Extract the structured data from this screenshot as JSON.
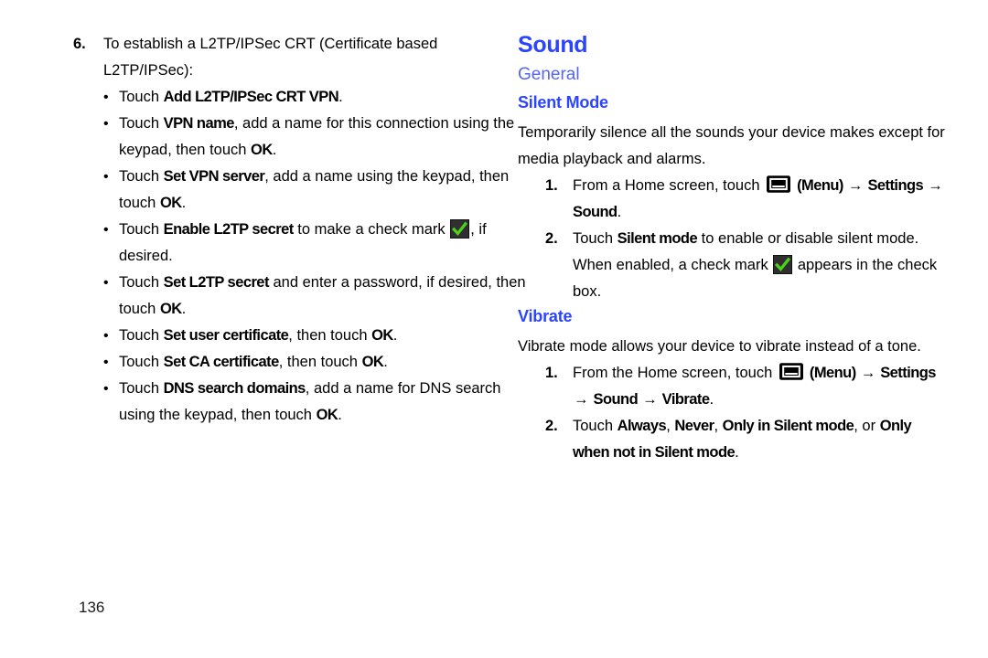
{
  "page": {
    "number": "136",
    "accent_blue": "#2b44ff",
    "section_blue": "#5566f2"
  },
  "left_column": {
    "step": {
      "number": "6.",
      "text_before": "To establish a L2TP/IPSec CRT (Certificate based L2TP/IPSec):"
    },
    "bullets": [
      {
        "id": "add-l2tp-ipsec-crt-vpn",
        "parts": [
          {
            "t": "Touch ",
            "b": false
          },
          {
            "t": "Add L2TP/IPSec CRT VPN",
            "b": true
          },
          {
            "t": ".",
            "b": false
          }
        ]
      },
      {
        "id": "vpn-name",
        "parts": [
          {
            "t": "Touch ",
            "b": false
          },
          {
            "t": "VPN name",
            "b": true
          },
          {
            "t": ", add a name for this connection using the keypad, then touch ",
            "b": false
          },
          {
            "t": "OK",
            "b": true
          },
          {
            "t": ".",
            "b": false
          }
        ]
      },
      {
        "id": "set-vpn-server",
        "parts": [
          {
            "t": "Touch ",
            "b": false
          },
          {
            "t": "Set VPN server",
            "b": true
          },
          {
            "t": ", add a name using the keypad, then touch ",
            "b": false
          },
          {
            "t": "OK",
            "b": true
          },
          {
            "t": ".",
            "b": false
          }
        ]
      },
      {
        "id": "enable-l2tp-secret",
        "parts": [
          {
            "t": "Touch ",
            "b": false
          },
          {
            "t": "Enable L2TP secret",
            "b": true
          },
          {
            "t": " to make a check mark ",
            "b": false
          },
          {
            "t": "",
            "icon": "checkbox-checked-icon"
          },
          {
            "t": ", if desired.",
            "b": false
          }
        ]
      },
      {
        "id": "set-l2tp-secret",
        "parts": [
          {
            "t": "Touch ",
            "b": false
          },
          {
            "t": "Set L2TP secret",
            "b": true
          },
          {
            "t": " and enter a password, if desired, then touch ",
            "b": false
          },
          {
            "t": "OK",
            "b": true
          },
          {
            "t": ".",
            "b": false
          }
        ]
      },
      {
        "id": "set-user-certificate",
        "parts": [
          {
            "t": "Touch ",
            "b": false
          },
          {
            "t": "Set user certificate",
            "b": true
          },
          {
            "t": ", then touch ",
            "b": false
          },
          {
            "t": "OK",
            "b": true
          },
          {
            "t": ".",
            "b": false
          }
        ]
      },
      {
        "id": "set-ca-certificate",
        "parts": [
          {
            "t": "Touch ",
            "b": false
          },
          {
            "t": "Set CA certificate",
            "b": true
          },
          {
            "t": ", then touch ",
            "b": false
          },
          {
            "t": "OK",
            "b": true
          },
          {
            "t": ".",
            "b": false
          }
        ]
      },
      {
        "id": "dns-search-domains",
        "parts": [
          {
            "t": "Touch ",
            "b": false
          },
          {
            "t": "DNS search domains",
            "b": true
          },
          {
            "t": ", add a name for DNS search using the keypad, then touch ",
            "b": false
          },
          {
            "t": "OK",
            "b": true
          },
          {
            "t": ".",
            "b": false
          }
        ]
      }
    ]
  },
  "right_column": {
    "chapter_title": "Sound",
    "section_title": "General",
    "topics": [
      {
        "id": "silent-mode",
        "heading": "Silent Mode",
        "intro": "Temporarily silence all the sounds your device makes except for media playback and alarms.",
        "steps": [
          {
            "number": "1.",
            "parts": [
              {
                "t": "From a Home screen, touch ",
                "b": false
              },
              {
                "t": "",
                "icon": "menu-icon"
              },
              {
                "t": " (Menu) ",
                "b": true
              },
              {
                "t": "→",
                "arrow": true
              },
              {
                "t": " Settings ",
                "b": true
              },
              {
                "t": "→",
                "arrow": true
              },
              {
                "t": " Sound",
                "b": true
              },
              {
                "t": ".",
                "b": false
              }
            ]
          },
          {
            "number": "2.",
            "parts": [
              {
                "t": "Touch ",
                "b": false
              },
              {
                "t": "Silent mode",
                "b": true
              },
              {
                "t": " to enable or disable silent mode. When enabled, a check mark ",
                "b": false
              },
              {
                "t": "",
                "icon": "checkbox-checked-icon"
              },
              {
                "t": " appears in the check box.",
                "b": false
              }
            ]
          }
        ]
      },
      {
        "id": "vibrate",
        "heading": "Vibrate",
        "intro": "Vibrate mode allows your device to vibrate instead of a tone.",
        "steps": [
          {
            "number": "1.",
            "parts": [
              {
                "t": "From the Home screen, touch ",
                "b": false
              },
              {
                "t": "",
                "icon": "menu-icon"
              },
              {
                "t": " (Menu) ",
                "b": true
              },
              {
                "t": "→",
                "arrow": true
              },
              {
                "t": " Settings ",
                "b": true
              },
              {
                "t": "→",
                "arrow": true
              },
              {
                "t": " Sound ",
                "b": true
              },
              {
                "t": "→",
                "arrow": true
              },
              {
                "t": " Vibrate",
                "b": true
              },
              {
                "t": ".",
                "b": false
              }
            ]
          },
          {
            "number": "2.",
            "parts": [
              {
                "t": "Touch ",
                "b": false
              },
              {
                "t": "Always",
                "b": true
              },
              {
                "t": ", ",
                "b": false
              },
              {
                "t": "Never",
                "b": true
              },
              {
                "t": ", ",
                "b": false
              },
              {
                "t": "Only in Silent mode",
                "b": true
              },
              {
                "t": ", or ",
                "b": false
              },
              {
                "t": "Only when not in Silent mode",
                "b": true
              },
              {
                "t": ".",
                "b": false
              }
            ]
          }
        ]
      }
    ]
  }
}
